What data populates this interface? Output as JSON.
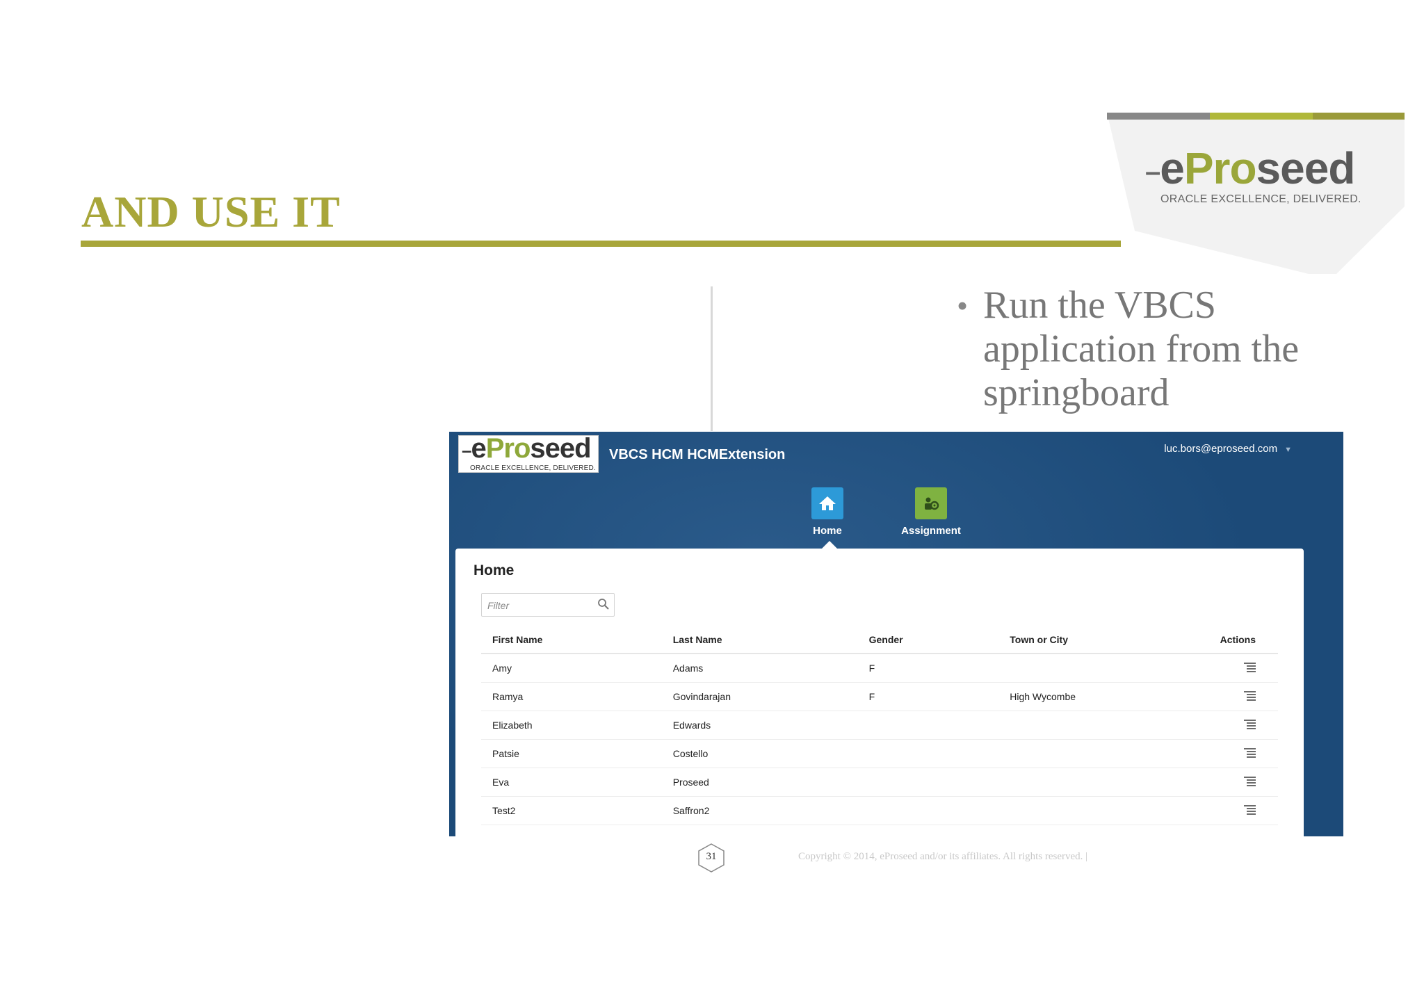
{
  "slide": {
    "title": "AND USE IT",
    "bullet": "Run the VBCS application from the springboard",
    "bullet_marker": "•",
    "page_number": "31",
    "copyright": "Copyright © 2014, eProseed and/or its affiliates. All rights reserved.  |",
    "accent_color": "#a8a63a"
  },
  "logo": {
    "e": "e",
    "pro": "Pro",
    "seed": "seed",
    "tagline": "ORACLE EXCELLENCE, DELIVERED."
  },
  "app": {
    "title": "VBCS HCM HCMExtension",
    "user": "luc.bors@eproseed.com",
    "user_menu_icon": "chevron-down-icon",
    "header_color": "#1c4a78",
    "nav": [
      {
        "label": "Home",
        "icon": "home-icon",
        "color": "#2d9ad8"
      },
      {
        "label": "Assignment",
        "icon": "assignment-icon",
        "color": "#7fb241"
      }
    ],
    "page_heading": "Home",
    "filter": {
      "placeholder": "Filter",
      "value": ""
    },
    "table": {
      "headers": [
        "First Name",
        "Last Name",
        "Gender",
        "Town or City",
        "Actions"
      ],
      "rows": [
        [
          "Amy",
          "Adams",
          "F",
          ""
        ],
        [
          "Ramya",
          "Govindarajan",
          "F",
          "High Wycombe"
        ],
        [
          "Elizabeth",
          "Edwards",
          "",
          ""
        ],
        [
          "Patsie",
          "Costello",
          "",
          ""
        ],
        [
          "Eva",
          "Proseed",
          "",
          ""
        ],
        [
          "Test2",
          "Saffron2",
          "",
          ""
        ]
      ]
    }
  }
}
